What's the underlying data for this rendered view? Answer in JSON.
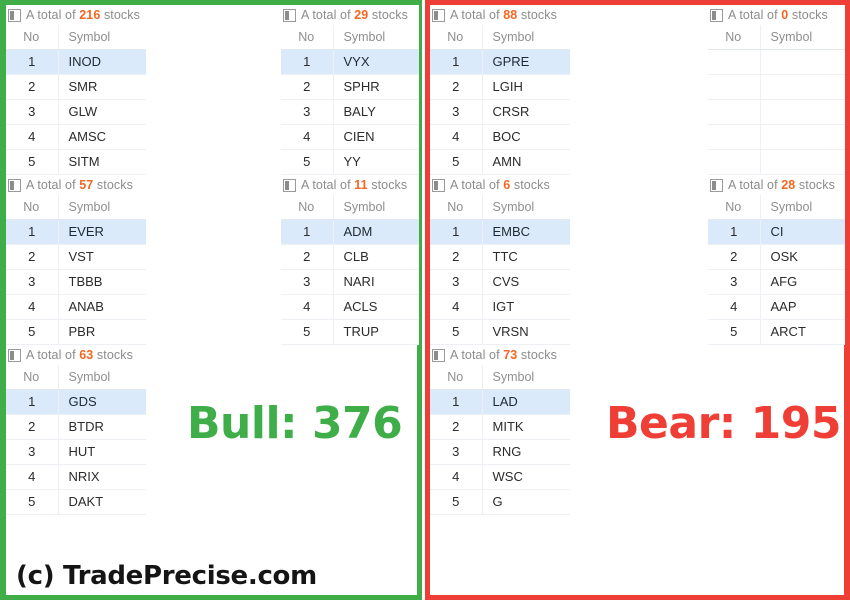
{
  "panels": {
    "bull": {
      "border_color": "#3fae49",
      "score_label": "Bull: 376"
    },
    "bear": {
      "border_color": "#ef3e36",
      "score_label": "Bear: 195"
    }
  },
  "common": {
    "header_prefix": "A total of",
    "header_suffix": "stocks",
    "col_no": "No",
    "col_symbol": "Symbol",
    "icon": "table-panel-icon",
    "count_color": "#f26722"
  },
  "widgets": [
    {
      "id": "bull-c1-w1",
      "count": "216",
      "rows": [
        {
          "no": "1",
          "symbol": "INOD"
        },
        {
          "no": "2",
          "symbol": "SMR"
        },
        {
          "no": "3",
          "symbol": "GLW"
        },
        {
          "no": "4",
          "symbol": "AMSC"
        },
        {
          "no": "5",
          "symbol": "SITM"
        }
      ]
    },
    {
      "id": "bull-c1-w2",
      "count": "57",
      "rows": [
        {
          "no": "1",
          "symbol": "EVER"
        },
        {
          "no": "2",
          "symbol": "VST"
        },
        {
          "no": "3",
          "symbol": "TBBB"
        },
        {
          "no": "4",
          "symbol": "ANAB"
        },
        {
          "no": "5",
          "symbol": "PBR"
        }
      ]
    },
    {
      "id": "bull-c1-w3",
      "count": "63",
      "rows": [
        {
          "no": "1",
          "symbol": "GDS"
        },
        {
          "no": "2",
          "symbol": "BTDR"
        },
        {
          "no": "3",
          "symbol": "HUT"
        },
        {
          "no": "4",
          "symbol": "NRIX"
        },
        {
          "no": "5",
          "symbol": "DAKT"
        }
      ]
    },
    {
      "id": "bull-c2-w1",
      "count": "29",
      "rows": [
        {
          "no": "1",
          "symbol": "VYX"
        },
        {
          "no": "2",
          "symbol": "SPHR"
        },
        {
          "no": "3",
          "symbol": "BALY"
        },
        {
          "no": "4",
          "symbol": "CIEN"
        },
        {
          "no": "5",
          "symbol": "YY"
        }
      ]
    },
    {
      "id": "bull-c2-w2",
      "count": "11",
      "rows": [
        {
          "no": "1",
          "symbol": "ADM"
        },
        {
          "no": "2",
          "symbol": "CLB"
        },
        {
          "no": "3",
          "symbol": "NARI"
        },
        {
          "no": "4",
          "symbol": "ACLS"
        },
        {
          "no": "5",
          "symbol": "TRUP"
        }
      ]
    },
    {
      "id": "bear-c1-w1",
      "count": "88",
      "rows": [
        {
          "no": "1",
          "symbol": "GPRE"
        },
        {
          "no": "2",
          "symbol": "LGIH"
        },
        {
          "no": "3",
          "symbol": "CRSR"
        },
        {
          "no": "4",
          "symbol": "BOC"
        },
        {
          "no": "5",
          "symbol": "AMN"
        }
      ]
    },
    {
      "id": "bear-c1-w2",
      "count": "6",
      "rows": [
        {
          "no": "1",
          "symbol": "EMBC"
        },
        {
          "no": "2",
          "symbol": "TTC"
        },
        {
          "no": "3",
          "symbol": "CVS"
        },
        {
          "no": "4",
          "symbol": "IGT"
        },
        {
          "no": "5",
          "symbol": "VRSN"
        }
      ]
    },
    {
      "id": "bear-c1-w3",
      "count": "73",
      "rows": [
        {
          "no": "1",
          "symbol": "LAD"
        },
        {
          "no": "2",
          "symbol": "MITK"
        },
        {
          "no": "3",
          "symbol": "RNG"
        },
        {
          "no": "4",
          "symbol": "WSC"
        },
        {
          "no": "5",
          "symbol": "G"
        }
      ]
    },
    {
      "id": "bear-c2-w1",
      "count": "0",
      "rows": [
        {
          "no": "",
          "symbol": ""
        },
        {
          "no": "",
          "symbol": ""
        },
        {
          "no": "",
          "symbol": ""
        },
        {
          "no": "",
          "symbol": ""
        },
        {
          "no": "",
          "symbol": ""
        }
      ]
    },
    {
      "id": "bear-c2-w2",
      "count": "28",
      "rows": [
        {
          "no": "1",
          "symbol": "CI"
        },
        {
          "no": "2",
          "symbol": "OSK"
        },
        {
          "no": "3",
          "symbol": "AFG"
        },
        {
          "no": "4",
          "symbol": "AAP"
        },
        {
          "no": "5",
          "symbol": "ARCT"
        }
      ]
    }
  ],
  "credit": "(c) TradePrecise.com"
}
